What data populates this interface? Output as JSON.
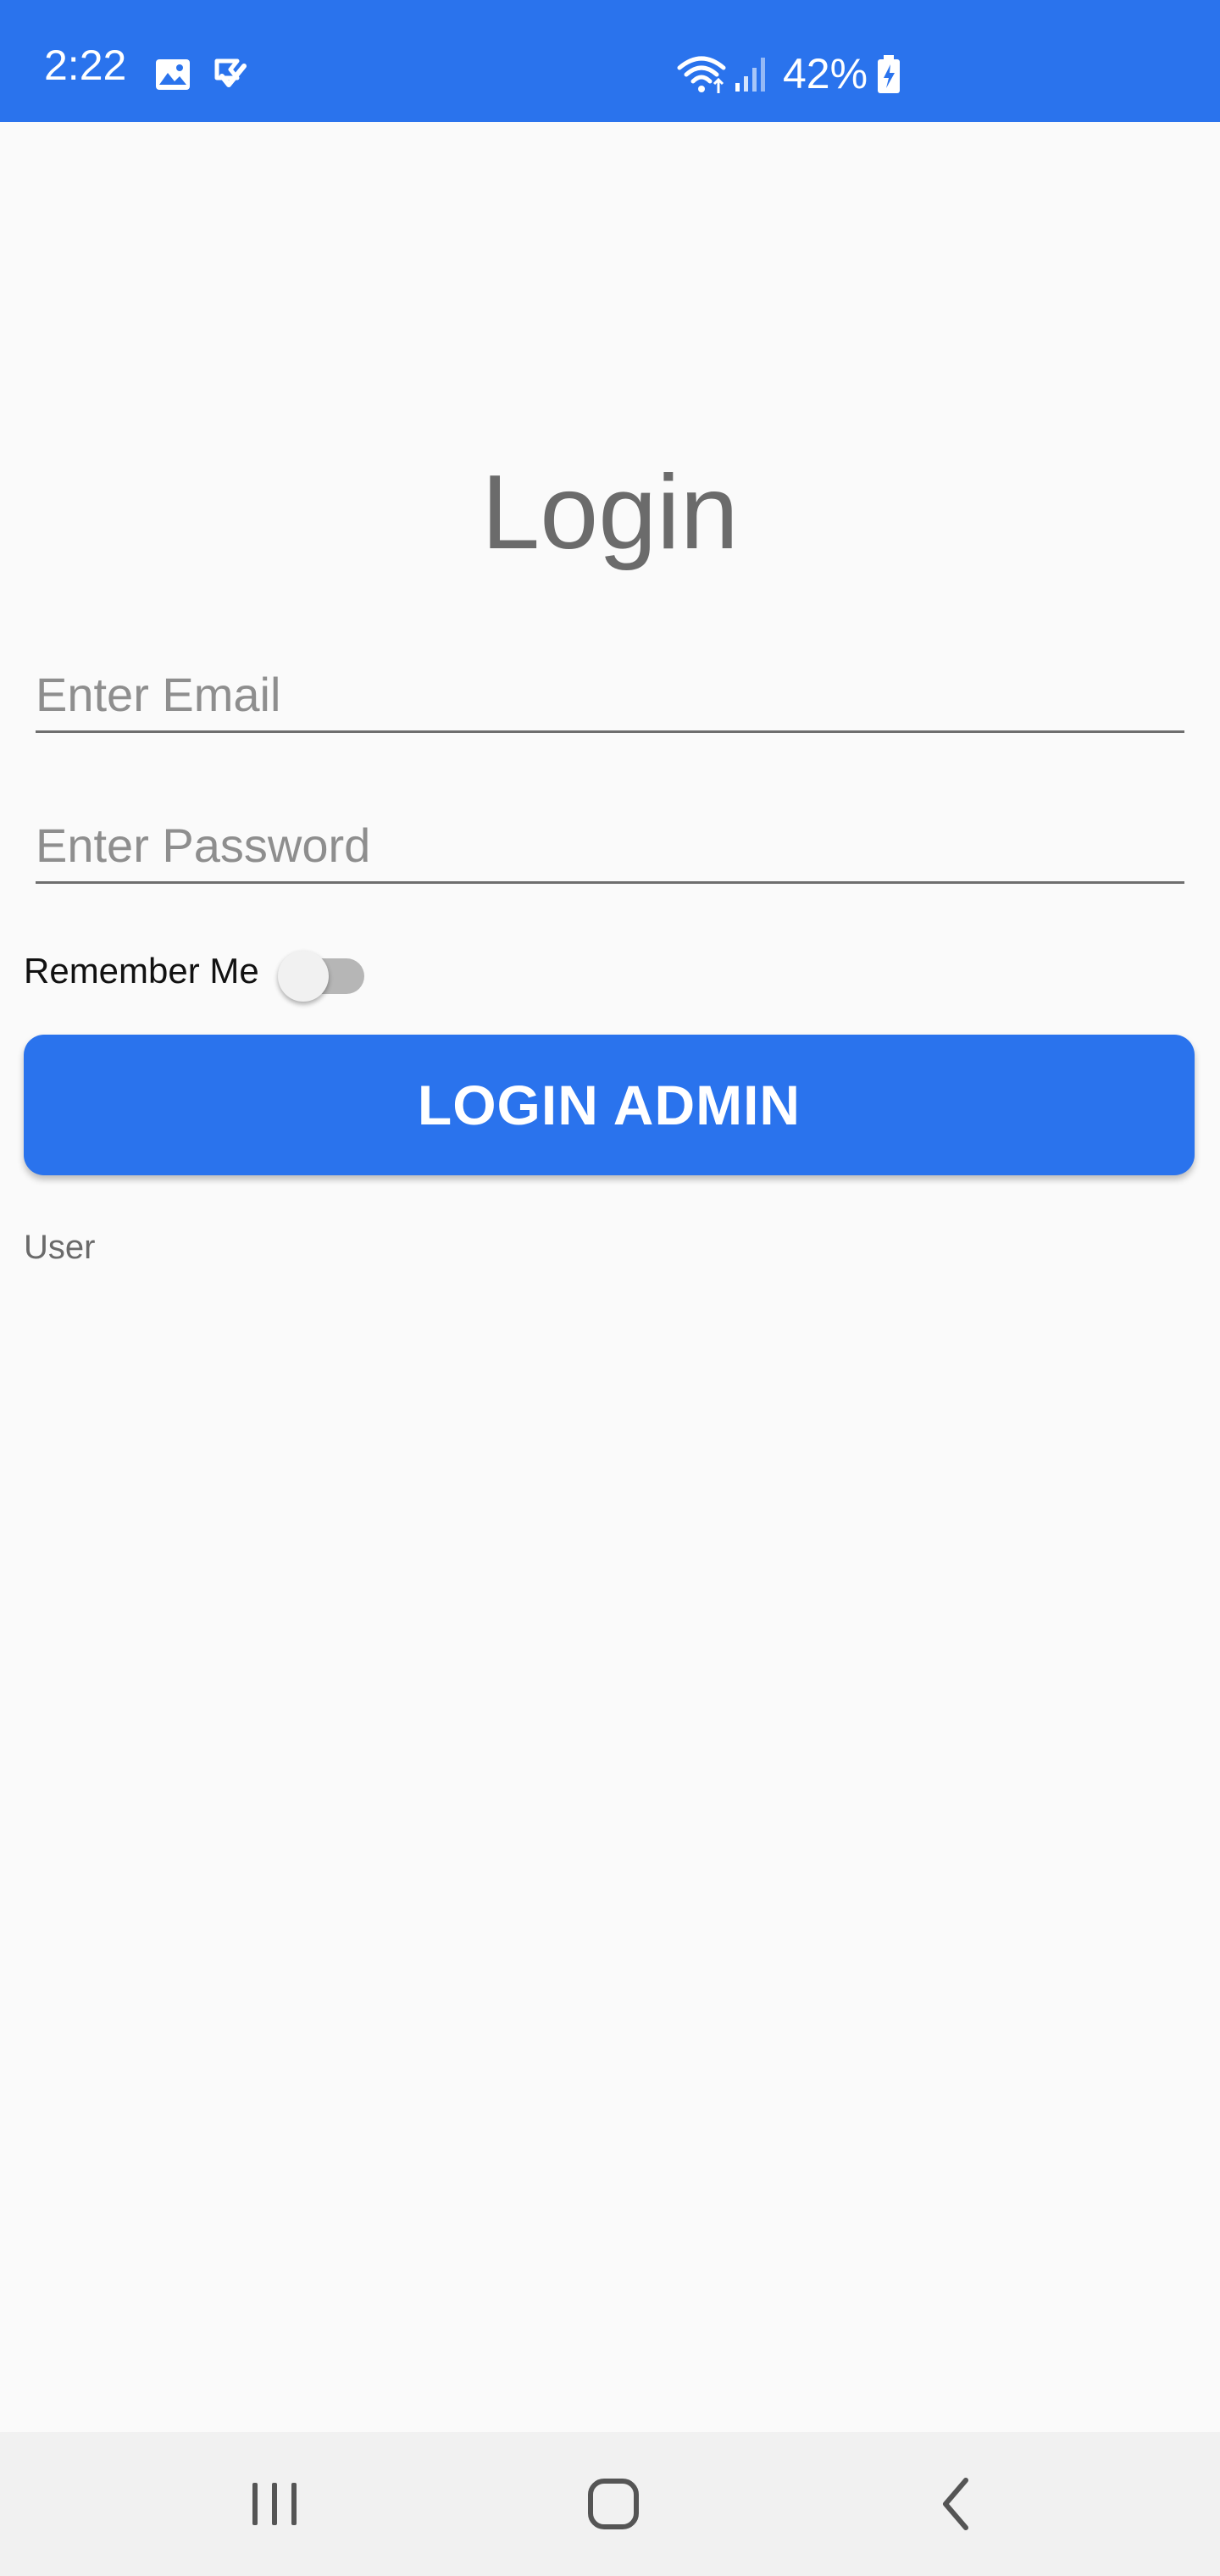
{
  "status_bar": {
    "time": "2:22",
    "battery_percent": "42%",
    "icons": [
      "gallery-icon",
      "task-check-icon",
      "wifi-icon",
      "signal-icon",
      "battery-charging-icon"
    ],
    "background_color": "#2a73ed"
  },
  "login": {
    "title": "Login",
    "email_placeholder": "Enter Email",
    "email_value": "",
    "password_placeholder": "Enter Password",
    "password_value": "",
    "remember_label": "Remember Me",
    "remember_checked": false,
    "button_label": "LOGIN ADMIN",
    "user_link": "User",
    "accent_color": "#2a73ed"
  },
  "nav_bar": {
    "icons": [
      "recent-apps-icon",
      "home-icon",
      "back-icon"
    ]
  }
}
